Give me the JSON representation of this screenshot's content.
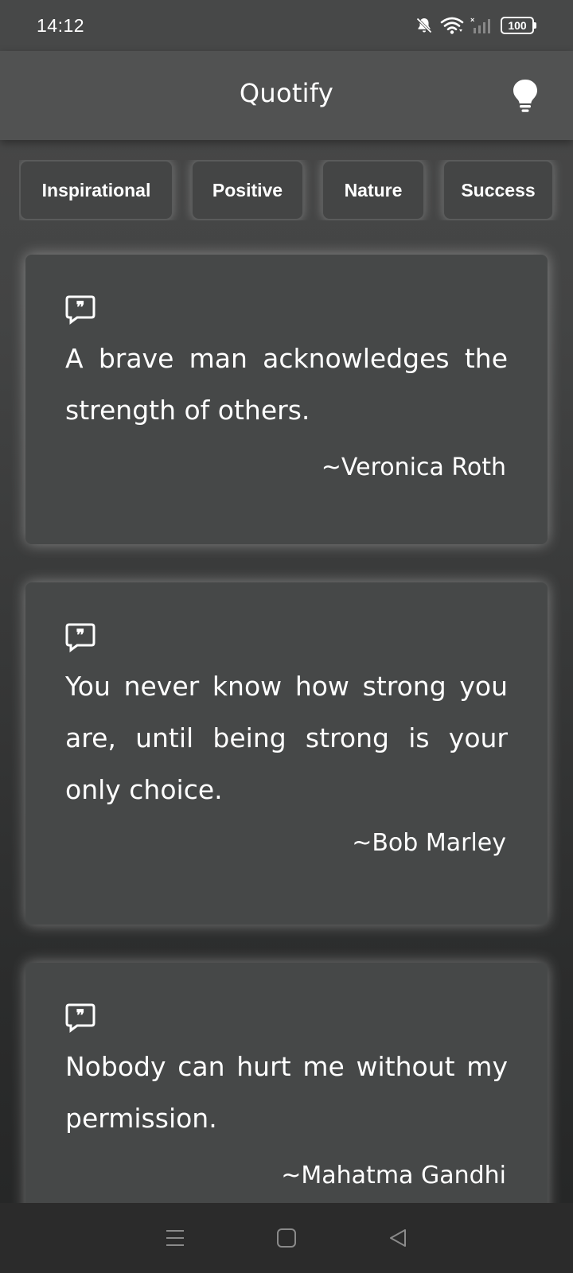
{
  "status_bar": {
    "time": "14:12",
    "battery": "100",
    "icons": [
      "bell-muted-icon",
      "wifi-icon",
      "signal-icon",
      "battery-icon"
    ]
  },
  "app_bar": {
    "title": "Quotify",
    "action_icon": "lightbulb-icon"
  },
  "categories": [
    {
      "label": "Inspirational"
    },
    {
      "label": "Positive"
    },
    {
      "label": "Nature"
    },
    {
      "label": "Success"
    }
  ],
  "quotes": [
    {
      "text": "A brave man acknowledges the strength of others.",
      "author": "~Veronica Roth"
    },
    {
      "text": "You never know how strong you are, until being strong is your only choice.",
      "author": "~Bob Marley"
    },
    {
      "text": "Nobody can hurt me without my permission.",
      "author": "~Mahatma Gandhi"
    }
  ],
  "nav_bar": {
    "icons": [
      "menu-icon",
      "home-icon",
      "back-icon"
    ]
  },
  "colors": {
    "background": "#2f3030",
    "app_bar": "#515252",
    "card": "#464848",
    "text": "#ffffff"
  }
}
